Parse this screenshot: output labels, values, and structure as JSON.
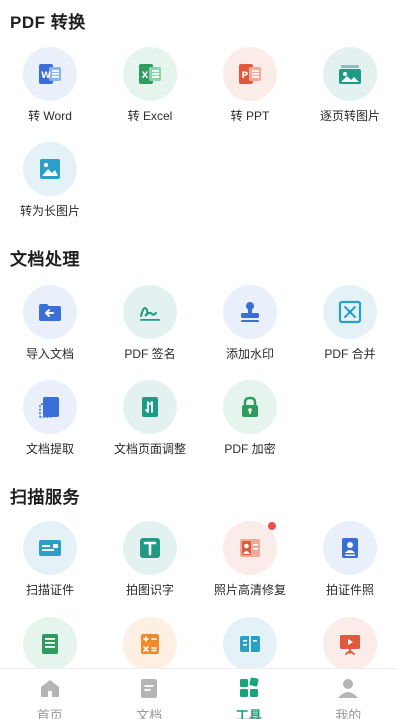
{
  "sections": {
    "pdf_convert": {
      "title": "PDF 转换",
      "items": [
        "转 Word",
        "转 Excel",
        "转 PPT",
        "逐页转图片",
        "转为长图片"
      ]
    },
    "doc_process": {
      "title": "文档处理",
      "items": [
        "导入文档",
        "PDF 签名",
        "添加水印",
        "PDF 合并",
        "文档提取",
        "文档页面调整",
        "PDF 加密"
      ]
    },
    "scan_service": {
      "title": "扫描服务",
      "items": [
        "扫描证件",
        "拍图识字",
        "照片高清修复",
        "拍证件照"
      ]
    }
  },
  "tabs": [
    {
      "label": "首页",
      "icon": "home-icon"
    },
    {
      "label": "文档",
      "icon": "document-icon"
    },
    {
      "label": "工具",
      "icon": "tools-grid-icon"
    },
    {
      "label": "我的",
      "icon": "user-icon"
    }
  ],
  "active_tab": "工具",
  "colors": {
    "word": "#3b6ed6",
    "excel": "#2f9b5e",
    "ppt": "#e0593e",
    "teal": "#1f9a85",
    "blue": "#3a6fd8",
    "cyan": "#2aa0c8",
    "orange": "#f08a2a",
    "active_tab": "#1aa37a",
    "notify_dot": "#f0504c"
  }
}
